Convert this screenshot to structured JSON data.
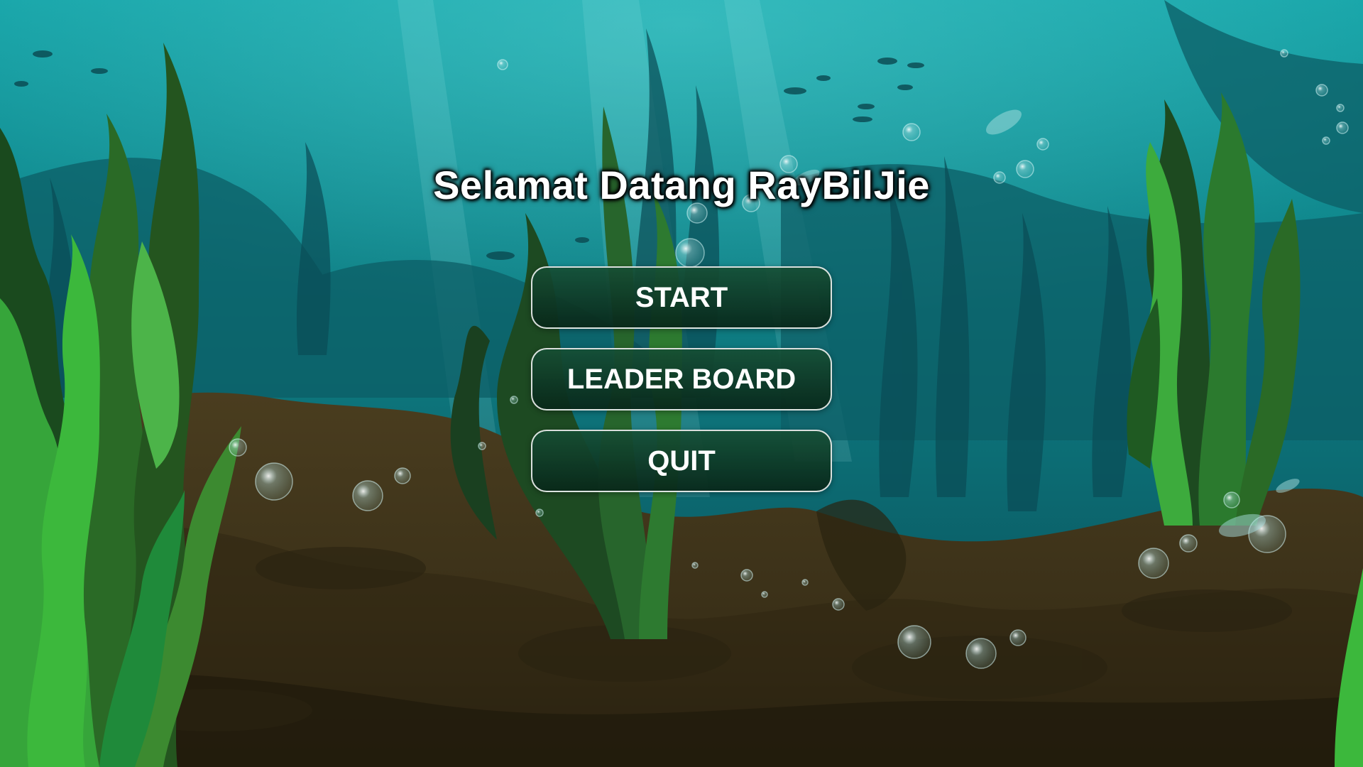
{
  "title": "Selamat Datang RayBilJie",
  "menu": {
    "start_label": "START",
    "leaderboard_label": "LEADER BOARD",
    "quit_label": "QUIT"
  },
  "colors": {
    "water_top": "#14a3a6",
    "water_deep": "#0b5560",
    "seabed": "#3d3219",
    "seabed_dark": "#231d0f",
    "seaweed_bright": "#3fbf3a",
    "seaweed_dark": "#1e5a24",
    "button_fill": "#0f3d28",
    "button_border": "#ffffff",
    "title_text": "#ffffff"
  }
}
